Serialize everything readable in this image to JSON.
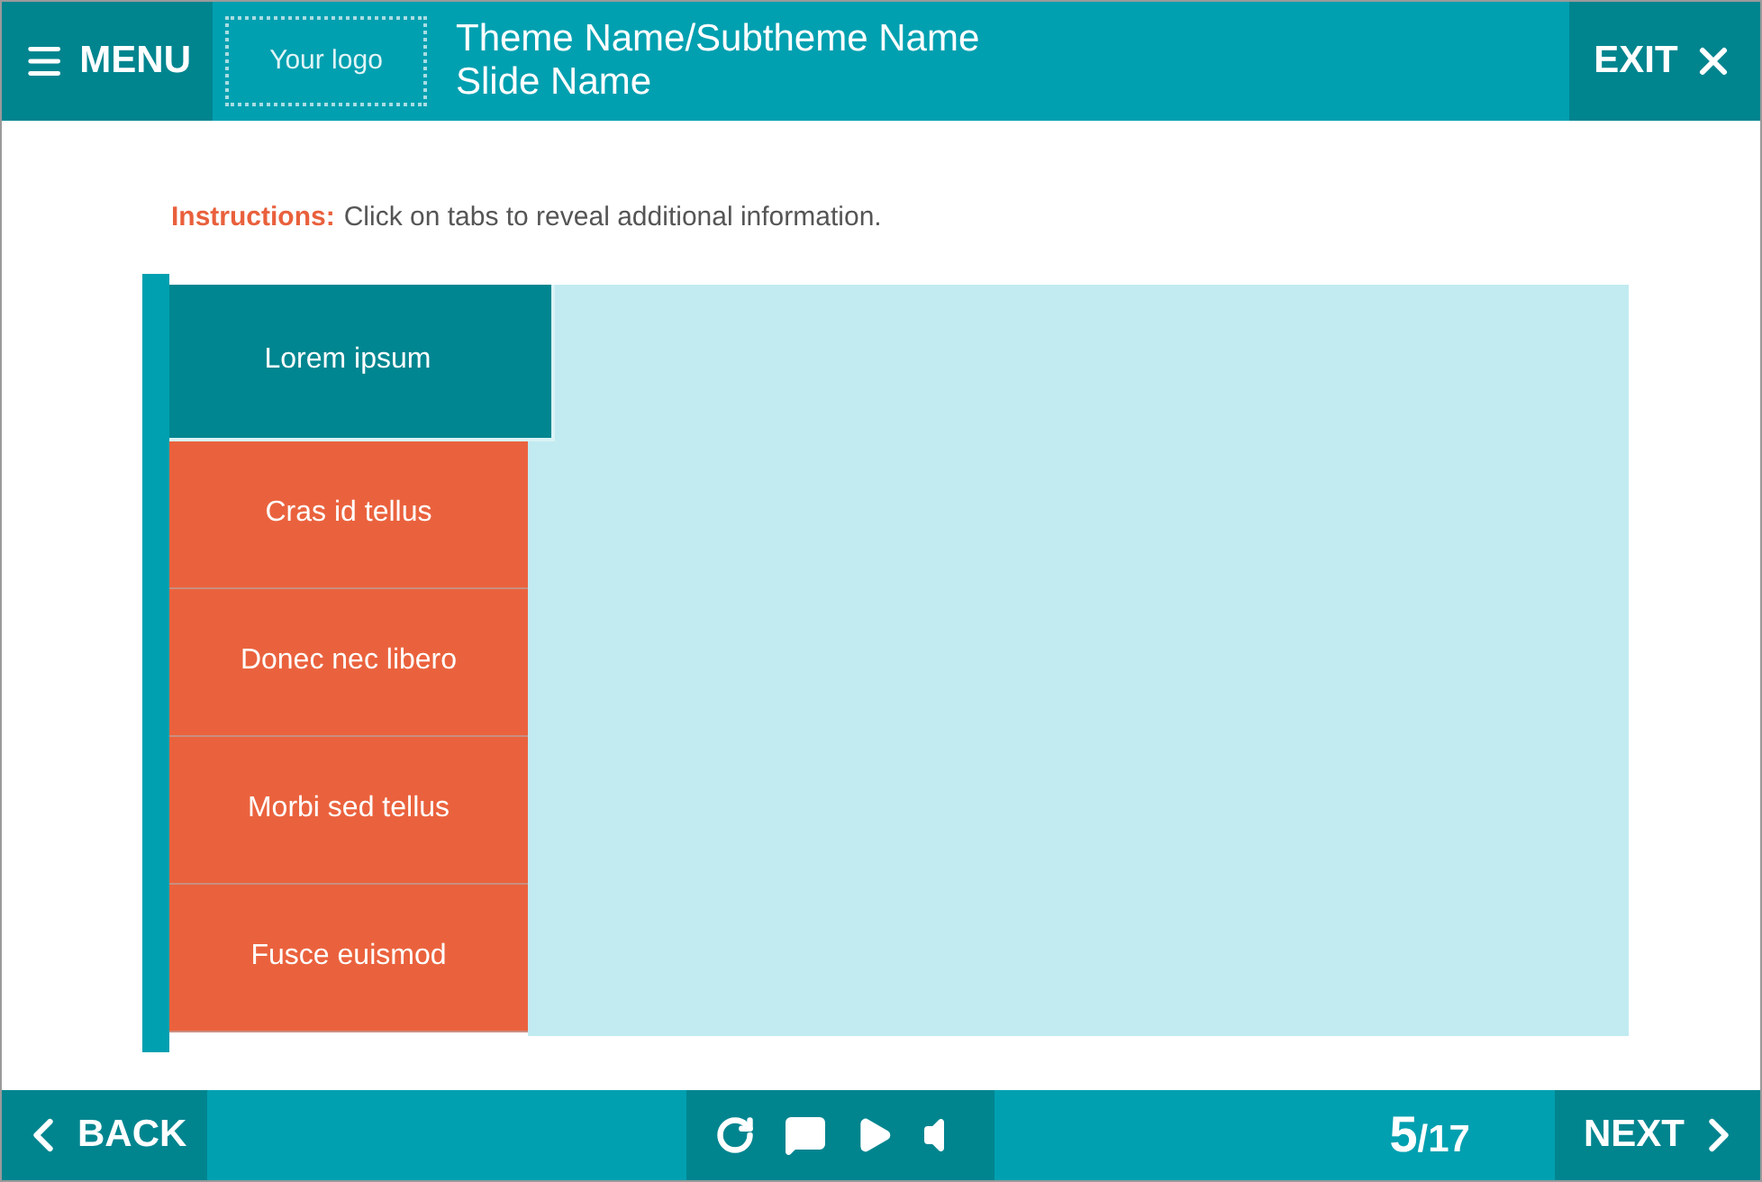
{
  "header": {
    "menu_label": "MENU",
    "logo": "Your logo",
    "title": "Theme Name/Subtheme Name",
    "subtitle": "Slide Name",
    "exit_label": "EXIT"
  },
  "instructions": {
    "label": "Instructions:",
    "text": "Click on tabs to reveal additional information."
  },
  "tabs": [
    {
      "label": "Lorem ipsum",
      "selected": true
    },
    {
      "label": "Cras id tellus",
      "selected": false
    },
    {
      "label": "Donec nec libero",
      "selected": false
    },
    {
      "label": "Morbi sed tellus",
      "selected": false
    },
    {
      "label": "Fusce euismod",
      "selected": false
    }
  ],
  "footer": {
    "back_label": "BACK",
    "current_page": "5",
    "total_pages": "/17",
    "next_label": "NEXT"
  }
}
